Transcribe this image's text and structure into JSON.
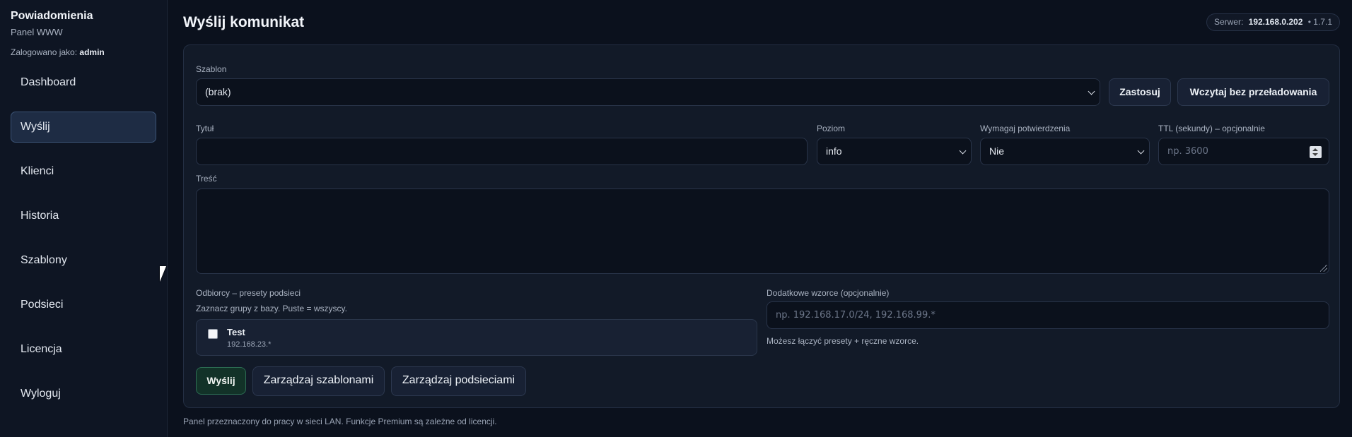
{
  "sidebar": {
    "brand_title": "Powiadomienia",
    "brand_sub": "Panel WWW",
    "logged_prefix": "Zalogowano jako:",
    "logged_user": "admin",
    "items": [
      {
        "label": "Dashboard",
        "active": false
      },
      {
        "label": "Wyślij",
        "active": true
      },
      {
        "label": "Klienci",
        "active": false
      },
      {
        "label": "Historia",
        "active": false
      },
      {
        "label": "Szablony",
        "active": false
      },
      {
        "label": "Podsieci",
        "active": false
      },
      {
        "label": "Licencja",
        "active": false
      },
      {
        "label": "Wyloguj",
        "active": false
      }
    ]
  },
  "header": {
    "title": "Wyślij komunikat",
    "server_label": "Serwer:",
    "server_ip": "192.168.0.202",
    "server_sep": "•",
    "version": "1.7.1"
  },
  "form": {
    "template_label": "Szablon",
    "template_value": "(brak)",
    "apply_button": "Zastosuj",
    "load_button": "Wczytaj bez przeładowania",
    "title_label": "Tytuł",
    "title_value": "",
    "level_label": "Poziom",
    "level_value": "info",
    "confirm_label": "Wymagaj potwierdzenia",
    "confirm_value": "Nie",
    "ttl_label": "TTL (sekundy) – opcjonalnie",
    "ttl_placeholder": "np. 3600",
    "body_label": "Treść",
    "recipients_label": "Odbiorcy – presety podsieci",
    "recipients_hint": "Zaznacz grupy z bazy. Puste = wszyscy.",
    "presets": [
      {
        "name": "Test",
        "network": "192.168.23.*",
        "checked": false
      }
    ],
    "patterns_label": "Dodatkowe wzorce (opcjonalnie)",
    "patterns_placeholder": "np. 192.168.17.0/24, 192.168.99.*",
    "patterns_hint": "Możesz łączyć presety + ręczne wzorce.",
    "send_button": "Wyślij",
    "manage_templates_button": "Zarządzaj szablonami",
    "manage_subnets_button": "Zarządzaj podsieciami"
  },
  "footer": "Panel przeznaczony do pracy w sieci LAN. Funkcje Premium są zależne od licencji.",
  "colors": {
    "background": "#0b111d",
    "sidebar": "#0e1523",
    "card": "#121a28",
    "active_nav": "#1e2c44",
    "primary_button": "#123228"
  }
}
